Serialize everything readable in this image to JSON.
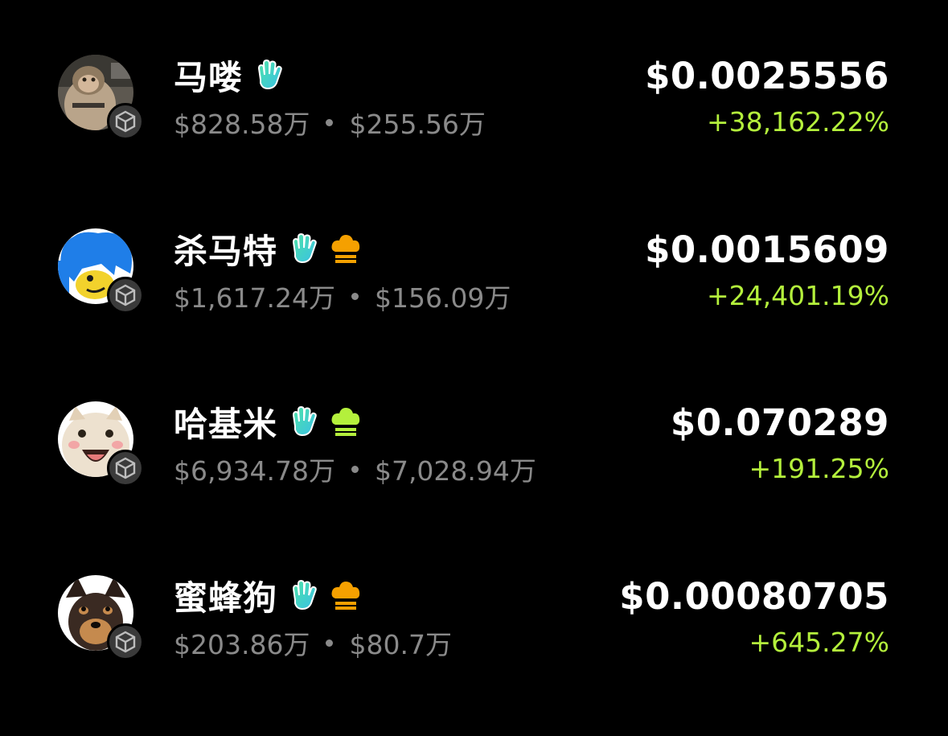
{
  "colors": {
    "background": "#000000",
    "primary_text": "#ffffff",
    "secondary_text": "#8a8a8a",
    "positive_change": "#b4f03c",
    "hand_badge_start": "#4de3a8",
    "hand_badge_end": "#3ac0e6",
    "chef_hat_orange": "#f5a000",
    "chef_hat_lime": "#b4f03c",
    "chain_badge_bg": "#3a3a3a"
  },
  "tokens": [
    {
      "name": "马喽",
      "market_cap": "$828.58万",
      "volume": "$255.56万",
      "price": "$0.0025556",
      "change": "+38,162.22%",
      "badges": [
        "hand-icon"
      ]
    },
    {
      "name": "杀马特",
      "market_cap": "$1,617.24万",
      "volume": "$156.09万",
      "price": "$0.0015609",
      "change": "+24,401.19%",
      "badges": [
        "hand-icon",
        "chef-hat-icon"
      ]
    },
    {
      "name": "哈基米",
      "market_cap": "$6,934.78万",
      "volume": "$7,028.94万",
      "price": "$0.070289",
      "change": "+191.25%",
      "badges": [
        "hand-icon",
        "chef-hat-icon"
      ]
    },
    {
      "name": "蜜蜂狗",
      "market_cap": "$203.86万",
      "volume": "$80.7万",
      "price": "$0.00080705",
      "change": "+645.27%",
      "badges": [
        "hand-icon",
        "chef-hat-icon"
      ]
    }
  ]
}
